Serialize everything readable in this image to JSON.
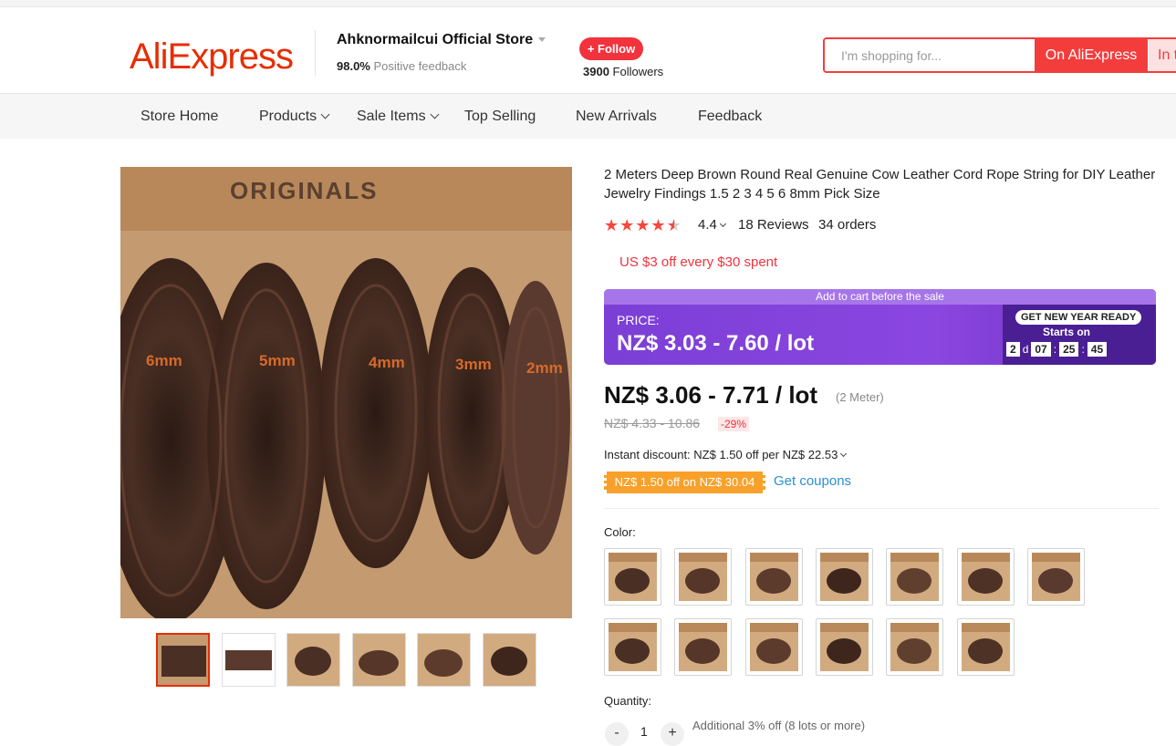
{
  "header": {
    "logo": "AliExpress",
    "store_name": "Ahknormailcui Official Store",
    "feedback_percent": "98.0%",
    "feedback_label": "Positive feedback",
    "follow_label": "+ Follow",
    "followers_count": "3900",
    "followers_label": "Followers",
    "search": {
      "placeholder": "I'm shopping for...",
      "btn_ali": "On AliExpress",
      "btn_store": "In this store"
    }
  },
  "nav": {
    "items": [
      {
        "label": "Store Home",
        "dropdown": false
      },
      {
        "label": "Products",
        "dropdown": true
      },
      {
        "label": "Sale Items",
        "dropdown": true
      },
      {
        "label": "Top Selling",
        "dropdown": false
      },
      {
        "label": "New Arrivals",
        "dropdown": false
      },
      {
        "label": "Feedback",
        "dropdown": false
      }
    ]
  },
  "gallery": {
    "main_box_label": "ORIGINALS",
    "sizes": [
      "6mm",
      "5mm",
      "4mm",
      "3mm",
      "2mm"
    ],
    "thumb_count": 6
  },
  "product": {
    "title": "2 Meters Deep Brown Round Real Genuine Cow Leather Cord Rope String for DIY Leather Jewelry Findings 1.5 2 3 4 5 6 8mm Pick Size",
    "rating": "4.4",
    "star_rating": 4.4,
    "reviews": "18 Reviews",
    "orders": "34 orders",
    "store_promo": "US $3 off every $30 spent"
  },
  "sale": {
    "top_text": "Add to cart before the sale",
    "price_label": "PRICE:",
    "sale_price": "NZ$ 3.03 - 7.60 / lot",
    "event": "GET NEW YEAR READY",
    "starts_on": "Starts on",
    "days": "2",
    "day_unit": "d",
    "hours": "07",
    "minutes": "25",
    "seconds": "45"
  },
  "pricing": {
    "price": "NZ$ 3.06 - 7.71 / lot",
    "unit": "(2 Meter)",
    "old_price": "NZ$ 4.33 - 10.86",
    "discount": "-29%",
    "instant_discount": "Instant discount: NZ$ 1.50 off per NZ$ 22.53",
    "coupon": "NZ$ 1.50 off on NZ$ 30.04",
    "get_coupons": "Get coupons"
  },
  "options": {
    "color_label": "Color:",
    "swatch_count": 13,
    "quantity_label": "Quantity:",
    "quantity": "1",
    "minus": "-",
    "plus": "+",
    "additional": "Additional 3% off (8 lots or more)"
  },
  "colors": {
    "brand_red": "#e62e04",
    "sale_purple": "#7b3fd6",
    "coupon_orange": "#f8a12a",
    "link_blue": "#2b8fd0"
  }
}
